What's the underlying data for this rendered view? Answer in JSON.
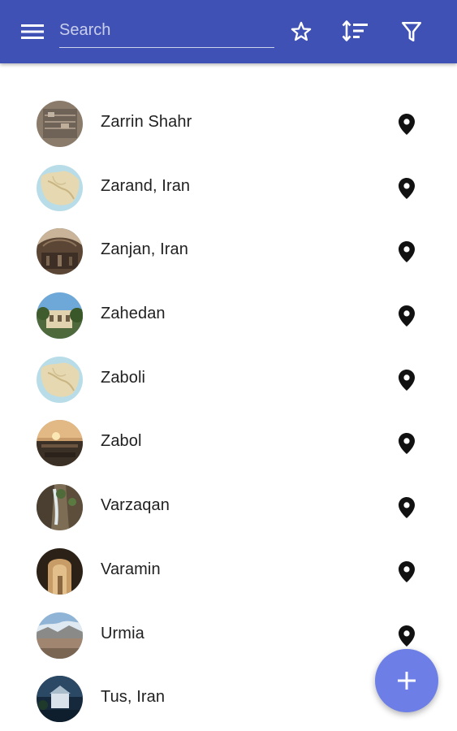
{
  "colors": {
    "toolbar": "#3f51b5",
    "fab": "#6d7fe6",
    "text": "#212121",
    "icon": "#111111"
  },
  "toolbar": {
    "menu_icon": "menu-icon",
    "search_placeholder": "Search",
    "search_value": "",
    "favorite_icon": "star-outline-icon",
    "sort_icon": "sort-icon",
    "filter_icon": "filter-icon"
  },
  "cities": [
    {
      "name": "Zarrin Shahr",
      "icon": "map-pin-icon"
    },
    {
      "name": "Zarand, Iran",
      "icon": "map-pin-icon"
    },
    {
      "name": "Zanjan, Iran",
      "icon": "map-pin-icon"
    },
    {
      "name": "Zahedan",
      "icon": "map-pin-icon"
    },
    {
      "name": "Zaboli",
      "icon": "map-pin-icon"
    },
    {
      "name": "Zabol",
      "icon": "map-pin-icon"
    },
    {
      "name": "Varzaqan",
      "icon": "map-pin-icon"
    },
    {
      "name": "Varamin",
      "icon": "map-pin-icon"
    },
    {
      "name": "Urmia",
      "icon": "map-pin-icon"
    },
    {
      "name": "Tus, Iran",
      "icon": "map-pin-icon"
    }
  ],
  "fab": {
    "icon": "add-icon"
  }
}
